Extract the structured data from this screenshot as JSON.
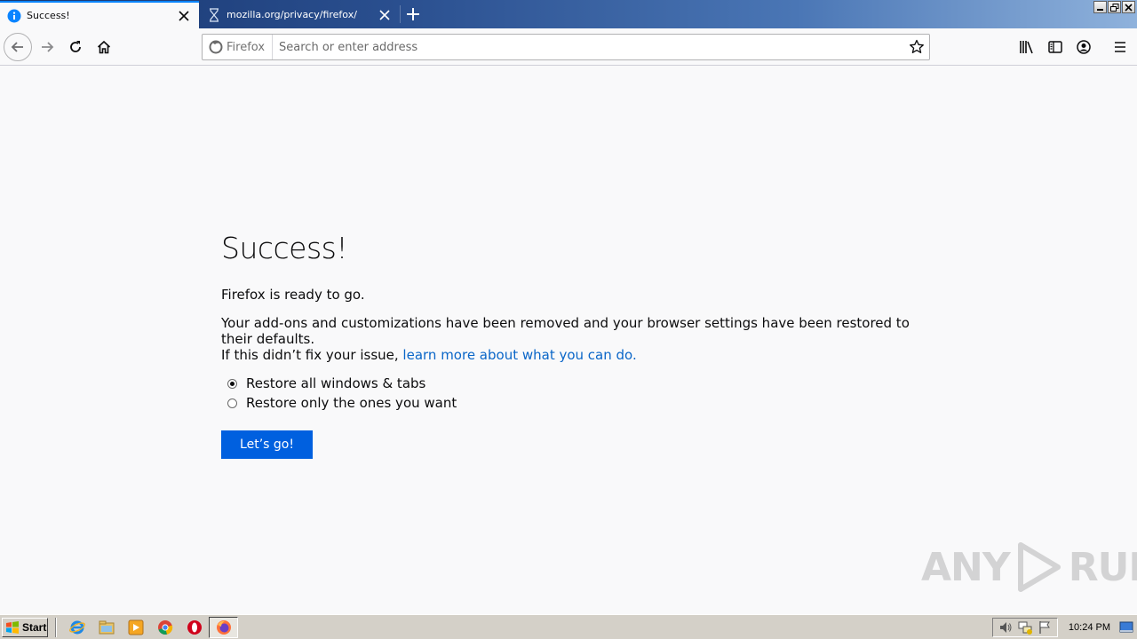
{
  "tabs": [
    {
      "title": "Success!",
      "icon": "info-icon",
      "active": true
    },
    {
      "title": "mozilla.org/privacy/firefox/",
      "icon": "loading-hourglass-icon",
      "active": false
    }
  ],
  "urlbar": {
    "identity_label": "Firefox",
    "placeholder": "Search or enter address",
    "value": ""
  },
  "page": {
    "title": "Success!",
    "ready_text": "Firefox is ready to go.",
    "body_text": "Your add-ons and customizations have been removed and your browser settings have been restored to their defaults.",
    "help_prefix": "If this didn’t fix your issue,",
    "help_link": "learn more about what you can do.",
    "options": [
      {
        "label": "Restore all windows & tabs",
        "checked": true
      },
      {
        "label": "Restore only the ones you want",
        "checked": false
      }
    ],
    "button_label": "Let’s go!"
  },
  "watermark": {
    "text_left": "ANY",
    "text_right": "RUN"
  },
  "taskbar": {
    "start_label": "Start",
    "quick_launch": [
      "internet-explorer-icon",
      "file-explorer-icon",
      "media-player-icon",
      "chrome-icon",
      "opera-icon",
      "firefox-icon"
    ],
    "clock": "10:24 PM"
  },
  "colors": {
    "accent": "#0060df",
    "link": "#0a66c8",
    "tab_highlight": "#0a84ff"
  }
}
